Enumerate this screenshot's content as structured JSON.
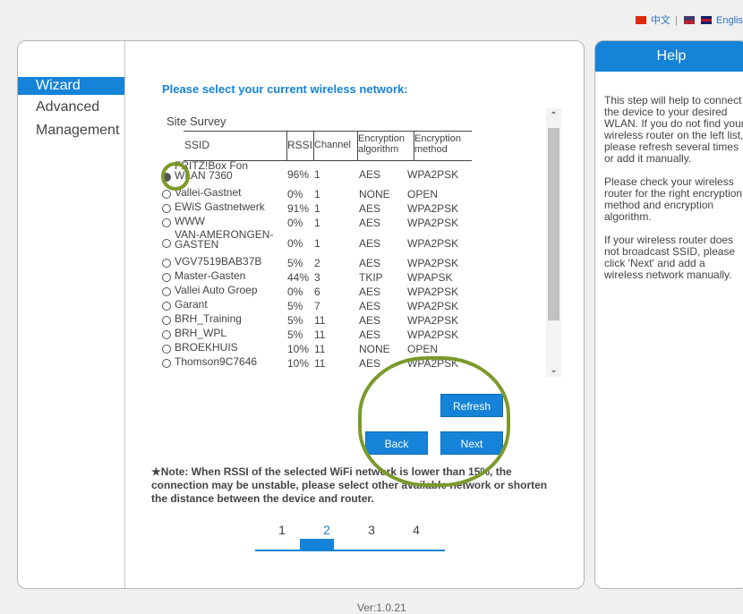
{
  "language": {
    "chinese": "中文",
    "separator": "|",
    "english": "Englis"
  },
  "nav": {
    "items": [
      {
        "label": "Wizard",
        "active": true
      },
      {
        "label": "Advanced",
        "active": false
      },
      {
        "label": "Management",
        "active": false
      }
    ]
  },
  "main": {
    "heading": "Please select your current wireless network:",
    "survey_label": "Site Survey",
    "columns": {
      "ssid": "SSID",
      "rssi": "RSSI",
      "channel": "Channel",
      "algorithm": "Encryption algorithm",
      "method": "Encryption method"
    },
    "networks": [
      {
        "ssid": "FRITZ!Box Fon WLAN 7360",
        "rssi": "96%",
        "channel": "1",
        "algorithm": "AES",
        "method": "WPA2PSK",
        "selected": true
      },
      {
        "ssid": "Vallei-Gastnet",
        "rssi": "0%",
        "channel": "1",
        "algorithm": "NONE",
        "method": "OPEN",
        "selected": false
      },
      {
        "ssid": "EWiS Gastnetwerk",
        "rssi": "91%",
        "channel": "1",
        "algorithm": "AES",
        "method": "WPA2PSK",
        "selected": false
      },
      {
        "ssid": "WWW",
        "rssi": "0%",
        "channel": "1",
        "algorithm": "AES",
        "method": "WPA2PSK",
        "selected": false
      },
      {
        "ssid": "VAN-AMERONGEN-GASTEN",
        "rssi": "0%",
        "channel": "1",
        "algorithm": "AES",
        "method": "WPA2PSK",
        "selected": false
      },
      {
        "ssid": "VGV7519BAB37B",
        "rssi": "5%",
        "channel": "2",
        "algorithm": "AES",
        "method": "WPA2PSK",
        "selected": false
      },
      {
        "ssid": "Master-Gasten",
        "rssi": "44%",
        "channel": "3",
        "algorithm": "TKIP",
        "method": "WPAPSK",
        "selected": false
      },
      {
        "ssid": "Vallei Auto Groep",
        "rssi": "0%",
        "channel": "6",
        "algorithm": "AES",
        "method": "WPA2PSK",
        "selected": false
      },
      {
        "ssid": "Garant",
        "rssi": "5%",
        "channel": "7",
        "algorithm": "AES",
        "method": "WPA2PSK",
        "selected": false
      },
      {
        "ssid": "BRH_Training",
        "rssi": "5%",
        "channel": "11",
        "algorithm": "AES",
        "method": "WPA2PSK",
        "selected": false
      },
      {
        "ssid": "BRH_WPL",
        "rssi": "5%",
        "channel": "11",
        "algorithm": "AES",
        "method": "WPA2PSK",
        "selected": false
      },
      {
        "ssid": "BROEKHUIS",
        "rssi": "10%",
        "channel": "11",
        "algorithm": "NONE",
        "method": "OPEN",
        "selected": false
      },
      {
        "ssid": "Thomson9C7646",
        "rssi": "10%",
        "channel": "11",
        "algorithm": "AES",
        "method": "WPA2PSK",
        "selected": false
      }
    ],
    "buttons": {
      "refresh": "Refresh",
      "back": "Back",
      "next": "Next"
    },
    "note": "★Note: When RSSI of the selected WiFi network is lower than 15%, the connection may be unstable, please select other available network or shorten the distance between the device and router.",
    "pager": {
      "pages": [
        "1",
        "2",
        "3",
        "4"
      ],
      "current": "2"
    }
  },
  "help": {
    "title": "Help",
    "paragraphs": [
      "This step will help to connect the device to your desired WLAN. If you do not find your wireless router on the left list, please refresh several times or add it manually.",
      "Please check your wireless router for the right encryption method and encryption algorithm.",
      "If your wireless router does not broadcast SSID, please click 'Next' and add a wireless network manually."
    ]
  },
  "footer": {
    "version": "Ver:1.0.21"
  },
  "colors": {
    "accent": "#1583d8",
    "highlight": "#7a9a2b"
  },
  "icons": {
    "scroll_up": "chevron-up-icon",
    "scroll_down": "chevron-down-icon"
  }
}
